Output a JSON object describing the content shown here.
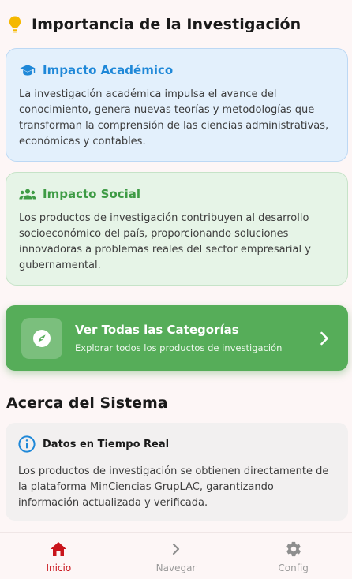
{
  "importance": {
    "title": "Importancia de la Investigación",
    "icon": "lightbulb-icon"
  },
  "cards": {
    "academic": {
      "title": "Impacto Académico",
      "text": "La investigación académica impulsa el avance del conocimiento, genera nuevas teorías y metodologías que transforman la comprensión de las ciencias administrativas, económicas y contables.",
      "icon": "graduation-cap-icon",
      "accent": "#1f88d8"
    },
    "social": {
      "title": "Impacto Social",
      "text": "Los productos de investigación contribuyen al desarrollo socioeconómico del país, proporcionando soluciones innovadoras a problemas reales del sector empresarial y gubernamental.",
      "icon": "people-icon",
      "accent": "#3e9b45"
    }
  },
  "cta": {
    "title": "Ver Todas las Categorías",
    "subtitle": "Explorar todos los productos de investigación",
    "icon": "compass-icon",
    "color": "#56ad59"
  },
  "about": {
    "title": "Acerca del Sistema",
    "info_title": "Datos en Tiempo Real",
    "info_text": "Los productos de investigación se obtienen directamente de la plataforma MinCiencias GrupLAC, garantizando información actualizada y verificada.",
    "icon": "info-icon"
  },
  "nav": {
    "items": [
      {
        "label": "Inicio",
        "icon": "home-icon",
        "active": true
      },
      {
        "label": "Navegar",
        "icon": "chevron-right-icon",
        "active": false
      },
      {
        "label": "Config",
        "icon": "gear-icon",
        "active": false
      }
    ],
    "active_color": "#c9141b"
  }
}
